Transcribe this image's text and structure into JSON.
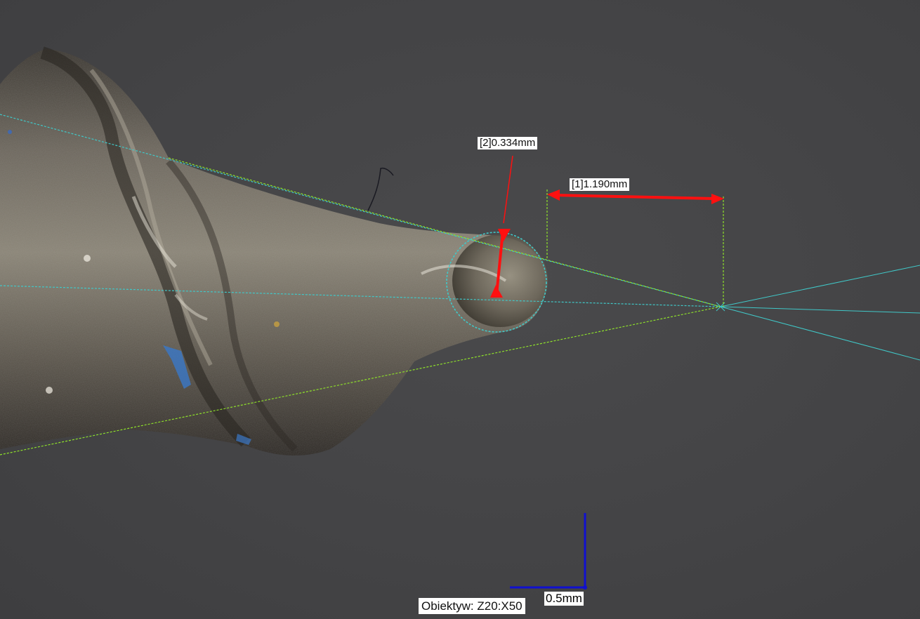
{
  "measurements": [
    {
      "id": "2",
      "label": "[2]0.334mm"
    },
    {
      "id": "1",
      "label": "[1]1.190mm"
    }
  ],
  "scale_bar": {
    "label": "0.5mm",
    "color": "#1010d0"
  },
  "objective": {
    "label": "Obiektyw: Z20:X50"
  },
  "colors": {
    "measurement": "#ff1010",
    "guide_cyan": "#40c8c8",
    "guide_green": "#8ee02a",
    "background": "#444446"
  }
}
